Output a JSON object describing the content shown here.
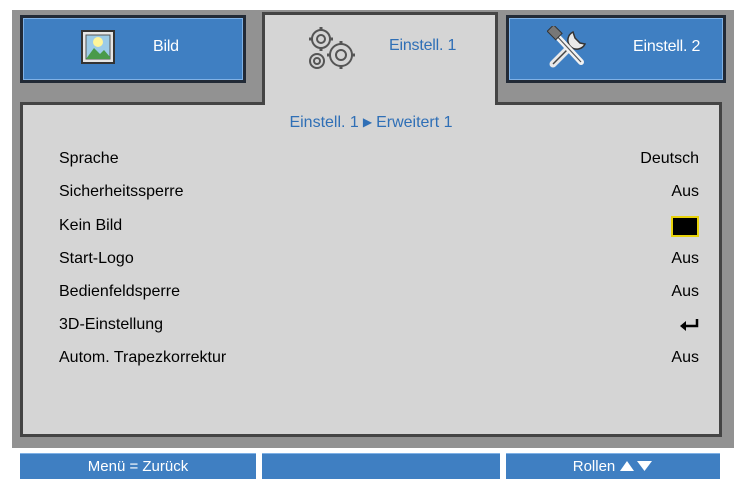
{
  "tabs": [
    {
      "label": "Bild",
      "icon": "picture-icon",
      "active": false
    },
    {
      "label": "Einstell. 1",
      "icon": "gears-icon",
      "active": true
    },
    {
      "label": "Einstell. 2",
      "icon": "tools-icon",
      "active": false
    }
  ],
  "breadcrumb": {
    "part1": "Einstell. 1",
    "separator": "▶",
    "part2": "Erweitert 1"
  },
  "rows": [
    {
      "label": "Sprache",
      "value": "Deutsch"
    },
    {
      "label": "Sicherheitssperre",
      "value": "Aus"
    },
    {
      "label": "Kein Bild",
      "value": "",
      "value_icon": "black-color-swatch"
    },
    {
      "label": "Start-Logo",
      "value": "Aus"
    },
    {
      "label": "Bedienfeldsperre",
      "value": "Aus"
    },
    {
      "label": "3D-Einstellung",
      "value": "",
      "value_icon": "enter-icon"
    },
    {
      "label": "Autom. Trapezkorrektur",
      "value": "Aus"
    }
  ],
  "footer": {
    "back": "Menü = Zurück",
    "middle": "",
    "scroll": "Rollen",
    "scroll_icon": "up-down-arrows-icon"
  },
  "colors": {
    "accent_blue": "#3f7fc2",
    "label_blue": "#2f6fb6",
    "panel_gray": "#d5d5d5",
    "frame_gray": "#929292",
    "highlight_yellow": "#e8d20a"
  }
}
